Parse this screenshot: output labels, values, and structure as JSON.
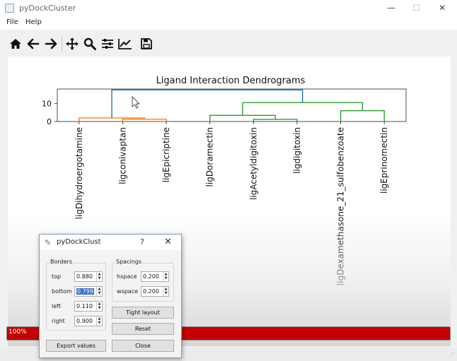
{
  "window": {
    "title": "pyDockCluster",
    "minimize": "—",
    "maximize": "☐",
    "close": "✕"
  },
  "menu": {
    "items": [
      "File",
      "Help"
    ]
  },
  "toolbar": {
    "icons": [
      "home-icon",
      "back-arrow-icon",
      "forward-arrow-icon",
      "pan-move-icon",
      "zoom-magnifier-icon",
      "configure-subplots-icon",
      "edit-axes-icon",
      "save-floppy-icon"
    ]
  },
  "chart_data": {
    "type": "dendrogram",
    "title": "Ligand Interaction Dendrograms",
    "ylim": [
      0,
      18
    ],
    "yticks": [
      "0",
      "10"
    ],
    "leaves": [
      "ligDihydroergotamine",
      "ligconivaptan",
      "ligEpicriptine",
      "ligDoramectin",
      "ligAcetyldigitoxin",
      "ligdigitoxin",
      "ligDexamethasone_21_sulfobenzoate",
      "ligEprinomectin"
    ],
    "clusters": [
      {
        "color": "#ff7f0e",
        "links": [
          {
            "left": [
              0,
              0
            ],
            "right": [
              1.5,
              1.3
            ],
            "height": 2.0
          },
          {
            "left": [
              1,
              0
            ],
            "right": [
              2,
              0
            ],
            "height": 1.3
          }
        ]
      },
      {
        "color": "#2ca02c",
        "links": [
          {
            "left": [
              4,
              0
            ],
            "right": [
              5,
              0
            ],
            "height": 1.2
          },
          {
            "left": [
              3,
              0
            ],
            "right": [
              4.5,
              1.2
            ],
            "height": 3.4
          },
          {
            "left": [
              6,
              0
            ],
            "right": [
              7,
              0
            ],
            "height": 6.0
          },
          {
            "left": [
              3.75,
              3.4
            ],
            "right": [
              6.5,
              6.0
            ],
            "height": 10.5
          }
        ]
      },
      {
        "color": "#1f77b4",
        "links": [
          {
            "left": [
              0.75,
              2.0
            ],
            "right": [
              5.125,
              10.5
            ],
            "height": 17.5
          }
        ]
      }
    ]
  },
  "progress": {
    "label": "100%",
    "value": 1.0,
    "color": "#c40000"
  },
  "dialog": {
    "title": "pyDockClust",
    "help": "?",
    "close": "✕",
    "borders": {
      "label": "Borders",
      "top_label": "top",
      "top_value": "0.880",
      "bottom_label": "bottom",
      "bottom_value": "0.799",
      "left_label": "left",
      "left_value": "0.110",
      "right_label": "right",
      "right_value": "0.900"
    },
    "spacings": {
      "label": "Spacings",
      "hspace_label": "hspace",
      "hspace_value": "0.200",
      "wspace_label": "wspace",
      "wspace_value": "0.200"
    },
    "tight_layout": "Tight layout",
    "reset": "Reset",
    "export": "Export values",
    "close_button": "Close"
  }
}
